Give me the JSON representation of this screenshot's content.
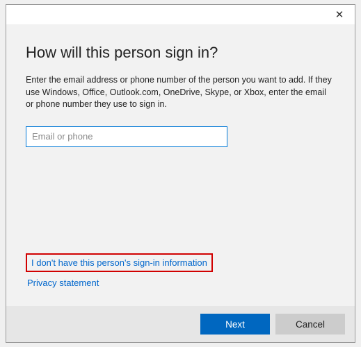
{
  "heading": "How will this person sign in?",
  "subtext": "Enter the email address or phone number of the person you want to add. If they use Windows, Office, Outlook.com, OneDrive, Skype, or Xbox, enter the email or phone number they use to sign in.",
  "input": {
    "placeholder": "Email or phone",
    "value": ""
  },
  "links": {
    "no_info": "I don't have this person's sign-in information",
    "privacy": "Privacy statement"
  },
  "buttons": {
    "next": "Next",
    "cancel": "Cancel"
  }
}
